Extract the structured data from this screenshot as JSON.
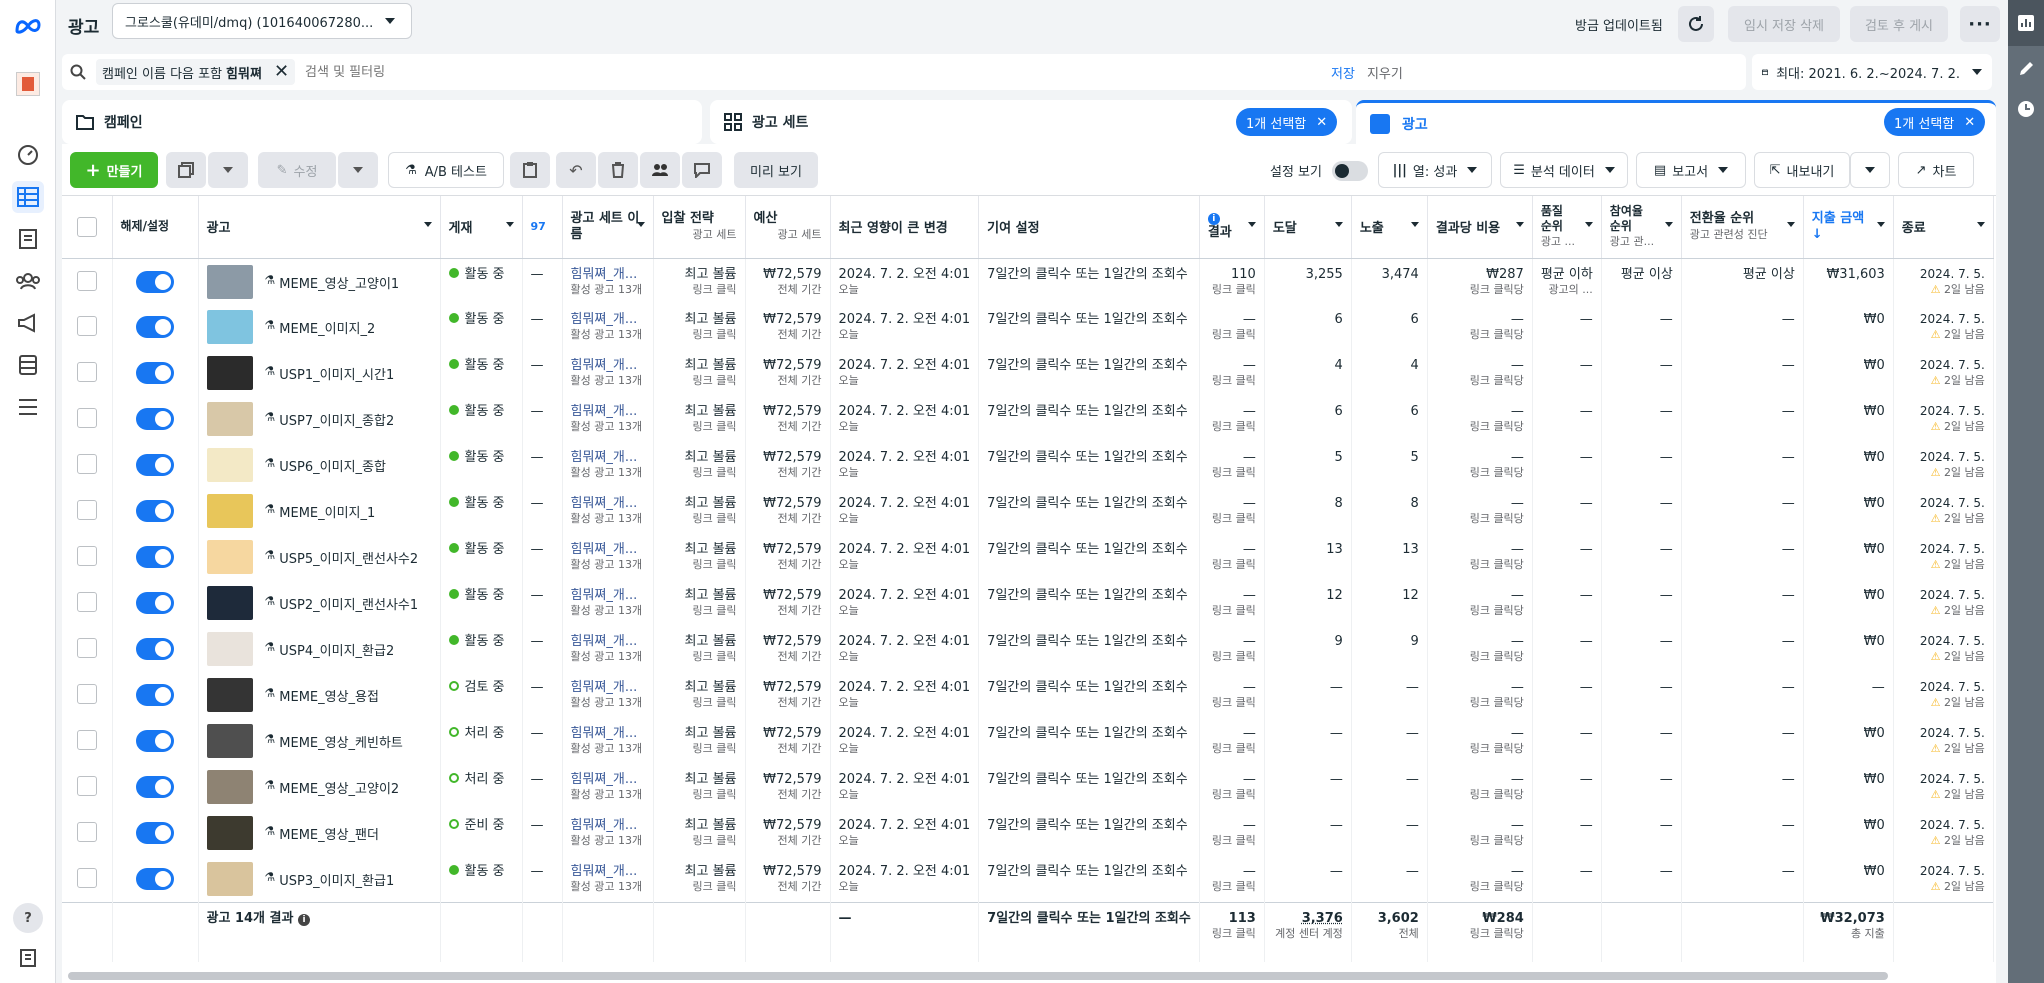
{
  "header": {
    "title": "광고",
    "account": "그로스쿨(유데미/dmq) (101640067280...",
    "updated": "방금 업데이트됨",
    "discard": "임시 저장 삭제",
    "review_publish": "검토 후 게시"
  },
  "search": {
    "filter_chip_prefix": "캠페인 이름 다음 포함",
    "filter_chip_value": "힘뭐쪄",
    "placeholder": "검색 및 필터링",
    "save": "저장",
    "clear": "지우기",
    "date_range": "최대: 2021. 6. 2.~2024. 7. 2."
  },
  "tabs": {
    "campaign": "캠페인",
    "adset": "광고 세트",
    "adset_selected": "1개 선택함",
    "ad": "광고",
    "ad_selected": "1개 선택함"
  },
  "toolbar": {
    "create": "만들기",
    "edit": "수정",
    "ab_test": "A/B 테스트",
    "preview": "미리 보기",
    "view_settings": "설정 보기",
    "columns": "열: 성과",
    "breakdown": "분석 데이터",
    "reports": "보고서",
    "export": "내보내기",
    "charts": "차트"
  },
  "columns": {
    "toggle": "해제/설정",
    "ad": "광고",
    "delivery": "게재",
    "hidden": "97",
    "adset_name": "광고 세트 이름",
    "bid": "입찰 전략",
    "bid_sub": "광고 세트",
    "budget": "예산",
    "budget_sub": "광고 세트",
    "last_change": "최근 영향이 큰 변경",
    "attribution": "기여 설정",
    "results": "결과",
    "reach": "도달",
    "impressions": "노출",
    "cpr": "결과당 비용",
    "quality": "품질 순위",
    "quality_sub": "광고 ...",
    "engagement": "참여율 순위",
    "engagement_sub": "광고 관...",
    "conversion": "전환율 순위",
    "conversion_sub": "광고 관련성 진단",
    "spent": "지출 금액",
    "end": "종료"
  },
  "colors": {
    "accent": "#1877f2",
    "active": "#42b72a",
    "warning": "#f7b928"
  },
  "rows": [
    {
      "name": "MEME_영상_고양이1",
      "status": "활동 중",
      "active": true,
      "results": "110",
      "results_sub": "링크 클릭",
      "reach": "3,255",
      "imp": "3,474",
      "cpr": "₩287",
      "cpr_sub": "링크 클릭당",
      "quality": "평균 이하",
      "quality_sub": "광고의 ...",
      "engage": "평균 이상",
      "conv": "평균 이상",
      "spent": "₩31,603"
    },
    {
      "name": "MEME_이미지_2",
      "status": "활동 중",
      "active": true,
      "results": "—",
      "results_sub": "링크 클릭",
      "reach": "6",
      "imp": "6",
      "cpr": "—",
      "cpr_sub": "링크 클릭당",
      "quality": "—",
      "quality_sub": "",
      "engage": "—",
      "conv": "—",
      "spent": "₩0"
    },
    {
      "name": "USP1_이미지_시간1",
      "status": "활동 중",
      "active": true,
      "results": "—",
      "results_sub": "링크 클릭",
      "reach": "4",
      "imp": "4",
      "cpr": "—",
      "cpr_sub": "링크 클릭당",
      "quality": "—",
      "quality_sub": "",
      "engage": "—",
      "conv": "—",
      "spent": "₩0"
    },
    {
      "name": "USP7_이미지_종합2",
      "status": "활동 중",
      "active": true,
      "results": "—",
      "results_sub": "링크 클릭",
      "reach": "6",
      "imp": "6",
      "cpr": "—",
      "cpr_sub": "링크 클릭당",
      "quality": "—",
      "quality_sub": "",
      "engage": "—",
      "conv": "—",
      "spent": "₩0"
    },
    {
      "name": "USP6_이미지_종합",
      "status": "활동 중",
      "active": true,
      "results": "—",
      "results_sub": "링크 클릭",
      "reach": "5",
      "imp": "5",
      "cpr": "—",
      "cpr_sub": "링크 클릭당",
      "quality": "—",
      "quality_sub": "",
      "engage": "—",
      "conv": "—",
      "spent": "₩0"
    },
    {
      "name": "MEME_이미지_1",
      "status": "활동 중",
      "active": true,
      "results": "—",
      "results_sub": "링크 클릭",
      "reach": "8",
      "imp": "8",
      "cpr": "—",
      "cpr_sub": "링크 클릭당",
      "quality": "—",
      "quality_sub": "",
      "engage": "—",
      "conv": "—",
      "spent": "₩0"
    },
    {
      "name": "USP5_이미지_랜선사수2",
      "status": "활동 중",
      "active": true,
      "results": "—",
      "results_sub": "링크 클릭",
      "reach": "13",
      "imp": "13",
      "cpr": "—",
      "cpr_sub": "링크 클릭당",
      "quality": "—",
      "quality_sub": "",
      "engage": "—",
      "conv": "—",
      "spent": "₩0"
    },
    {
      "name": "USP2_이미지_랜선사수1",
      "status": "활동 중",
      "active": true,
      "results": "—",
      "results_sub": "링크 클릭",
      "reach": "12",
      "imp": "12",
      "cpr": "—",
      "cpr_sub": "링크 클릭당",
      "quality": "—",
      "quality_sub": "",
      "engage": "—",
      "conv": "—",
      "spent": "₩0"
    },
    {
      "name": "USP4_이미지_환급2",
      "status": "활동 중",
      "active": true,
      "results": "—",
      "results_sub": "링크 클릭",
      "reach": "9",
      "imp": "9",
      "cpr": "—",
      "cpr_sub": "링크 클릭당",
      "quality": "—",
      "quality_sub": "",
      "engage": "—",
      "conv": "—",
      "spent": "₩0"
    },
    {
      "name": "MEME_영상_용접",
      "status": "검토 중",
      "active": false,
      "results": "—",
      "results_sub": "링크 클릭",
      "reach": "—",
      "imp": "—",
      "cpr": "—",
      "cpr_sub": "링크 클릭당",
      "quality": "—",
      "quality_sub": "",
      "engage": "—",
      "conv": "—",
      "spent": "—"
    },
    {
      "name": "MEME_영상_케빈하트",
      "status": "처리 중",
      "active": false,
      "results": "—",
      "results_sub": "링크 클릭",
      "reach": "—",
      "imp": "—",
      "cpr": "—",
      "cpr_sub": "링크 클릭당",
      "quality": "—",
      "quality_sub": "",
      "engage": "—",
      "conv": "—",
      "spent": "₩0"
    },
    {
      "name": "MEME_영상_고양이2",
      "status": "처리 중",
      "active": false,
      "results": "—",
      "results_sub": "링크 클릭",
      "reach": "—",
      "imp": "—",
      "cpr": "—",
      "cpr_sub": "링크 클릭당",
      "quality": "—",
      "quality_sub": "",
      "engage": "—",
      "conv": "—",
      "spent": "₩0"
    },
    {
      "name": "MEME_영상_팬더",
      "status": "준비 중",
      "active": false,
      "results": "—",
      "results_sub": "링크 클릭",
      "reach": "—",
      "imp": "—",
      "cpr": "—",
      "cpr_sub": "링크 클릭당",
      "quality": "—",
      "quality_sub": "",
      "engage": "—",
      "conv": "—",
      "spent": "₩0"
    },
    {
      "name": "USP3_이미지_환급1",
      "status": "활동 중",
      "active": true,
      "results": "—",
      "results_sub": "링크 클릭",
      "reach": "—",
      "imp": "—",
      "cpr": "—",
      "cpr_sub": "링크 클릭당",
      "quality": "—",
      "quality_sub": "",
      "engage": "—",
      "conv": "—",
      "spent": "₩0"
    }
  ],
  "row_common": {
    "hidden": "—",
    "adset": "힘뭐쪄_개...",
    "adset_sub": "활성 광고 13개",
    "bid": "최고 볼륨",
    "bid_sub": "링크 클릭",
    "budget": "₩72,579",
    "budget_sub": "전체 기간",
    "change": "2024. 7. 2. 오전 4:01",
    "change_sub": "오늘",
    "attribution": "7일간의 클릭수 또는 1일간의 조회수",
    "end": "2024. 7. 5.",
    "end_sub": "2일 남음"
  },
  "footer": {
    "label": "광고 14개 결과",
    "last_change": "—",
    "attribution": "7일간의 클릭수 또는 1일간의 조회수",
    "results": "113",
    "results_sub": "링크 클릭",
    "reach": "3,376",
    "reach_sub": "계정 센터 계정",
    "imp": "3,602",
    "imp_sub": "전체",
    "cpr": "₩284",
    "cpr_sub": "링크 클릭당",
    "spent": "₩32,073",
    "spent_sub": "총 지출"
  }
}
